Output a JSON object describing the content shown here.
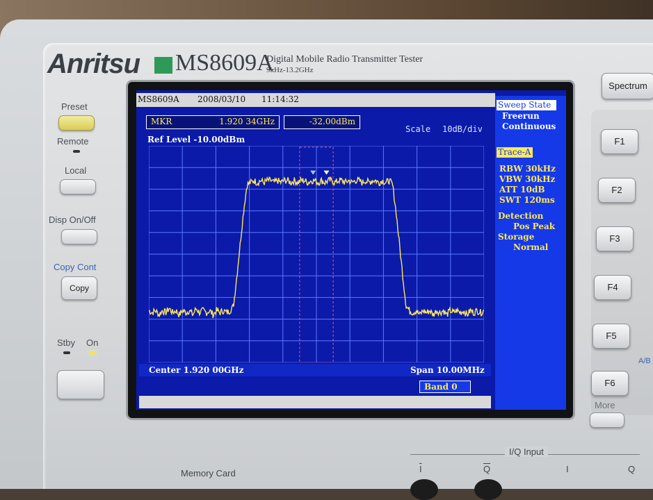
{
  "instrument": {
    "brand": "Anritsu",
    "model": "MS8609A",
    "subtitle": "Digital Mobile Radio Transmitter Tester",
    "freq_range": "9kHz-13.2GHz"
  },
  "left_controls": {
    "preset_label": "Preset",
    "remote_label": "Remote",
    "local_label": "Local",
    "disp_label": "Disp On/Off",
    "copy_cont_label": "Copy Cont",
    "copy_button": "Copy",
    "stby_label": "Stby",
    "on_label": "On"
  },
  "screen": {
    "model": "MS8609A",
    "date": "2008/03/10",
    "time": "11:14:32",
    "mkr_label": "MKR",
    "mkr_freq": "1.920 34GHz",
    "mkr_level": "-32.00dBm",
    "scale_label": "Scale",
    "scale_value": "10dB/div",
    "ref_level": "Ref Level -10.00dBm",
    "center": "Center 1.920 00GHz",
    "span": "Span 10.00MHz",
    "band": "Band 0"
  },
  "side": {
    "sweep_state_title": "Sweep State",
    "sweep_mode": "Freerun",
    "sweep_cont": "Continuous",
    "trace_title": "Trace-A",
    "rbw": "RBW 30kHz",
    "vbw": "VBW 30kHz",
    "att": "ATT 10dB",
    "swt": "SWT 120ms",
    "detection_label": "Detection",
    "detection_value": "Pos Peak",
    "storage_label": "Storage",
    "storage_value": "Normal"
  },
  "right_controls": {
    "spectrum_button": "Spectrum",
    "fkeys": [
      "F1",
      "F2",
      "F3",
      "F4",
      "F5",
      "F6"
    ],
    "more_label": "More",
    "ab_label": "A/B"
  },
  "bottom": {
    "memory_card": "Memory Card",
    "iq_input": "I/Q Input",
    "i_bar": "I",
    "q_bar": "Q",
    "i": "I",
    "q": "Q"
  },
  "chart_data": {
    "type": "line",
    "series": [
      {
        "values_dbm": [
          -86,
          -87,
          -86,
          -88,
          -86,
          -87,
          -85,
          -87,
          -86,
          -88,
          -86,
          -87,
          -86,
          -88,
          -85,
          -87,
          -86,
          -87,
          -86,
          -88,
          -86,
          -87,
          -86,
          -87,
          -86,
          -84,
          -70,
          -55,
          -40,
          -28,
          -27,
          -26,
          -27,
          -26,
          -27,
          -26,
          -26,
          -27,
          -26,
          -27,
          -26,
          -26,
          -27,
          -26,
          -27,
          -26,
          -26,
          -27,
          -26,
          -26,
          -27,
          -26,
          -27,
          -26,
          -26,
          -27,
          -26,
          -26,
          -27,
          -26,
          -27,
          -26,
          -26,
          -27,
          -26,
          -27,
          -26,
          -26,
          -27,
          -26,
          -27,
          -26,
          -28,
          -40,
          -55,
          -70,
          -84,
          -86,
          -87,
          -86,
          -88,
          -86,
          -87,
          -86,
          -88,
          -86,
          -87,
          -86,
          -88,
          -86,
          -87,
          -86,
          -87,
          -86,
          -88,
          -86,
          -87,
          -86,
          -87,
          -86
        ]
      }
    ],
    "x_center_ghz": 1.92,
    "x_span_mhz": 10.0,
    "ref_level_dbm": -10.0,
    "scale_db_per_div": 10,
    "divisions_x": 10,
    "divisions_y": 10,
    "grid": true,
    "trace_color": "#ffe85a",
    "grid_color": "#5c78ff",
    "background_color": "#0b1aa8",
    "marker_window_start_frac": 0.45,
    "marker_window_end_frac": 0.55,
    "marker_positions_frac": [
      0.49,
      0.53
    ]
  }
}
